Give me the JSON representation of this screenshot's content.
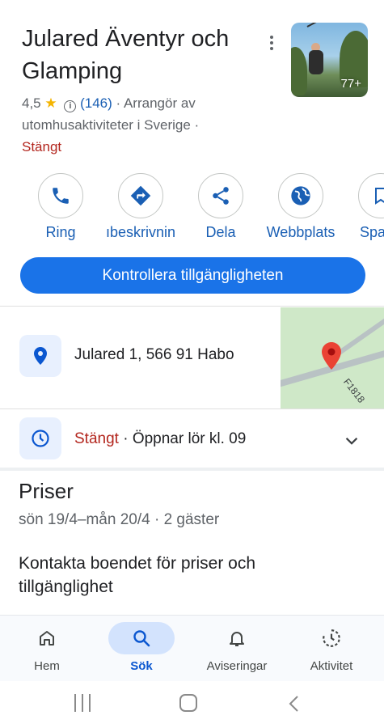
{
  "place": {
    "title": "Julared Äventyr och Glamping",
    "rating": "4,5",
    "reviews": "(146)",
    "category": "· Arrangör av utomhusaktiviteter i Sverige ·",
    "category_part1": "· Arrangör av",
    "category_part2": "utomhusaktiviteter i Sverige ·",
    "status": "Stängt",
    "photo_count": "77+"
  },
  "actions": [
    {
      "label": "Ring",
      "icon": "phone-icon"
    },
    {
      "label": "ıbeskrivnin",
      "icon": "directions-icon"
    },
    {
      "label": "Dela",
      "icon": "share-icon"
    },
    {
      "label": "Webbplats",
      "icon": "globe-icon"
    },
    {
      "label": "Spa",
      "icon": "bookmark-icon"
    }
  ],
  "cta_label": "Kontrollera tillgängligheten",
  "address": {
    "text": "Julared 1, 566 91 Habo",
    "map_label": "F1818"
  },
  "hours": {
    "status": "Stängt",
    "detail": " · Öppnar lör kl. 09"
  },
  "prices": {
    "title": "Priser",
    "dates": "sön 19/4–mån 20/4 · 2 gäster",
    "contact": "Kontakta boendet för priser och tillgänglighet"
  },
  "bottom_nav": [
    {
      "label": "Hem",
      "icon": "home-icon"
    },
    {
      "label": "Sök",
      "icon": "search-icon",
      "active": true
    },
    {
      "label": "Aviseringar",
      "icon": "bell-icon"
    },
    {
      "label": "Aktivitet",
      "icon": "activity-icon"
    }
  ],
  "colors": {
    "accent": "#1a73e8",
    "link": "#1a5fb4",
    "closed": "#b3261e",
    "star": "#f4b400"
  }
}
